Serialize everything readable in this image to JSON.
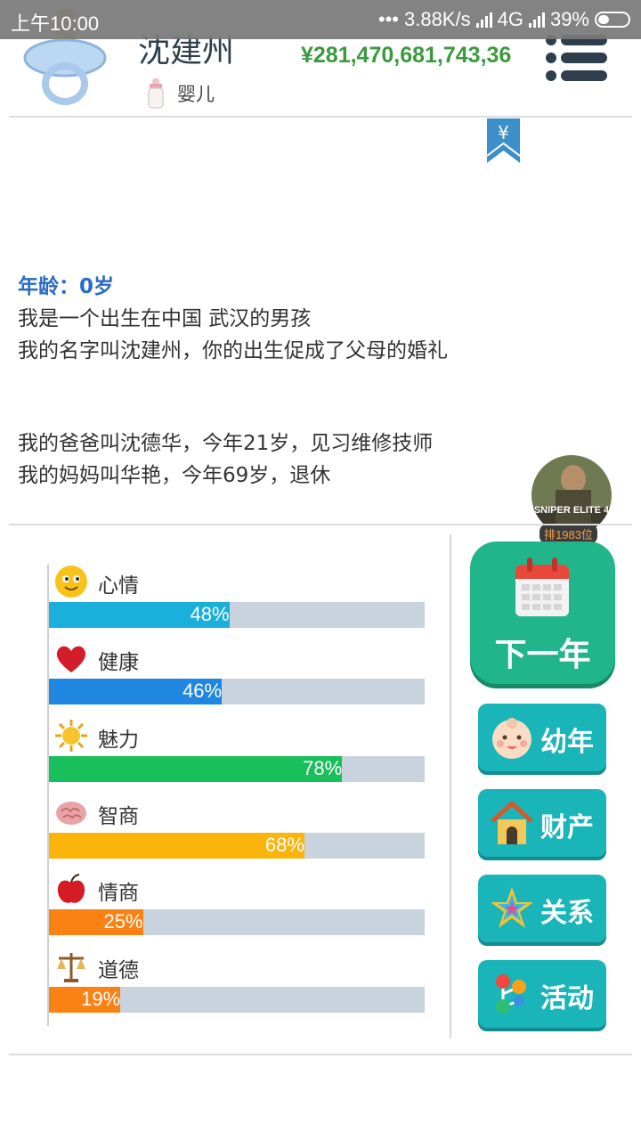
{
  "status_bar": {
    "time": "上午10:00",
    "network_speed": "3.88K/s",
    "network_type": "4G",
    "battery": "39%"
  },
  "header": {
    "name": "沈建州",
    "life_stage": "婴儿",
    "money": "¥281,470,681,743,36",
    "avatar_icon": "pacifier-icon",
    "menu_icon": "list-menu-icon"
  },
  "ribbon": {
    "symbol": "¥"
  },
  "story": {
    "age_line": "年龄：0岁",
    "lines1": [
      "我是一个出生在中国 武汉的男孩",
      "我的名字叫沈建州，你的出生促成了父母的婚礼"
    ],
    "lines2": [
      "我的爸爸叫沈德华，今年21岁，见习维修技师",
      "我的妈妈叫华艳，今年69岁，退休"
    ]
  },
  "rank": {
    "game_title": "SNIPER ELITE 4",
    "label": "排1983位"
  },
  "stats": [
    {
      "label": "心情",
      "value": 48,
      "pct": "48%",
      "color": "#1ab0db",
      "icon": "smiley-face-icon"
    },
    {
      "label": "健康",
      "value": 46,
      "pct": "46%",
      "color": "#1f87df",
      "icon": "heart-icon"
    },
    {
      "label": "魅力",
      "value": 78,
      "pct": "78%",
      "color": "#18bf5b",
      "icon": "sun-icon"
    },
    {
      "label": "智商",
      "value": 68,
      "pct": "68%",
      "color": "#fbb40a",
      "icon": "brain-icon"
    },
    {
      "label": "情商",
      "value": 25,
      "pct": "25%",
      "color": "#fa8214",
      "icon": "apple-icon"
    },
    {
      "label": "道德",
      "value": 19,
      "pct": "19%",
      "color": "#fa8214",
      "icon": "scales-icon"
    }
  ],
  "buttons": {
    "next_year": "下一年",
    "childhood": "幼年",
    "assets": "财产",
    "relations": "关系",
    "activities": "活动"
  }
}
